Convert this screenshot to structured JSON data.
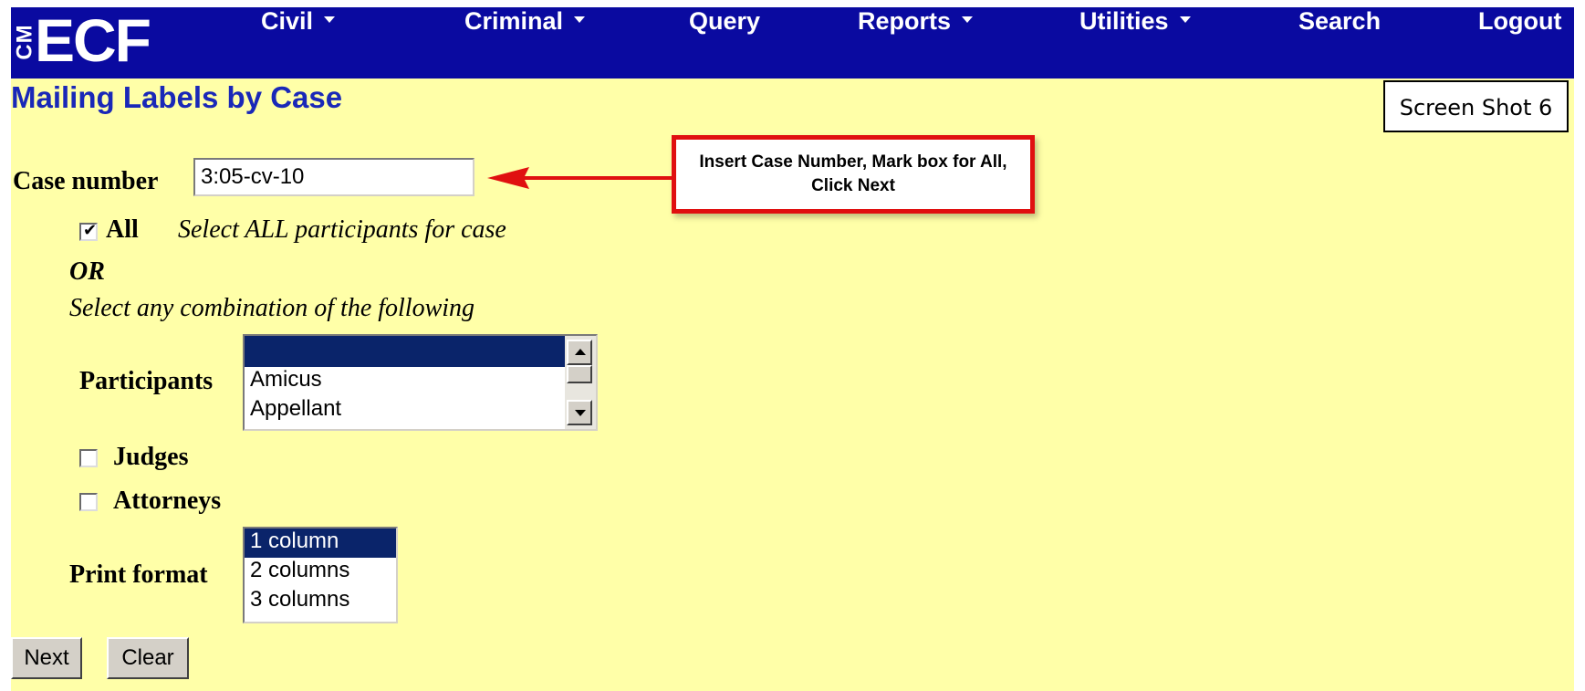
{
  "header": {
    "logo_cm": "CM",
    "logo_ecf": "ECF",
    "nav": [
      {
        "label": "Civil",
        "dropdown": true
      },
      {
        "label": "Criminal",
        "dropdown": true
      },
      {
        "label": "Query",
        "dropdown": false
      },
      {
        "label": "Reports",
        "dropdown": true
      },
      {
        "label": "Utilities",
        "dropdown": true
      },
      {
        "label": "Search",
        "dropdown": false
      },
      {
        "label": "Logout",
        "dropdown": false
      }
    ]
  },
  "page": {
    "title": "Mailing Labels by Case",
    "screenshot_label": "Screen Shot 6",
    "callout": "Insert Case Number, Mark box for All, Click Next"
  },
  "form": {
    "case_number_label": "Case number",
    "case_number_value": "3:05-cv-10",
    "all_label": "All",
    "all_checked": true,
    "all_description": "Select ALL participants for case",
    "or_label": "OR",
    "combination_label": "Select any combination of the following",
    "participants_label": "Participants",
    "participants_options": [
      "",
      "Amicus",
      "Appellant"
    ],
    "judges_label": "Judges",
    "judges_checked": false,
    "attorneys_label": "Attorneys",
    "attorneys_checked": false,
    "print_format_label": "Print format",
    "print_format_options": [
      "1 column",
      "2 columns",
      "3 columns"
    ],
    "print_format_selected": "1 column",
    "next_label": "Next",
    "clear_label": "Clear"
  },
  "colors": {
    "navbar": "#0a0aa0",
    "page_bg": "#ffffa8",
    "title": "#1a28b8",
    "callout_border": "#e01010",
    "selection": "#0a246a"
  }
}
